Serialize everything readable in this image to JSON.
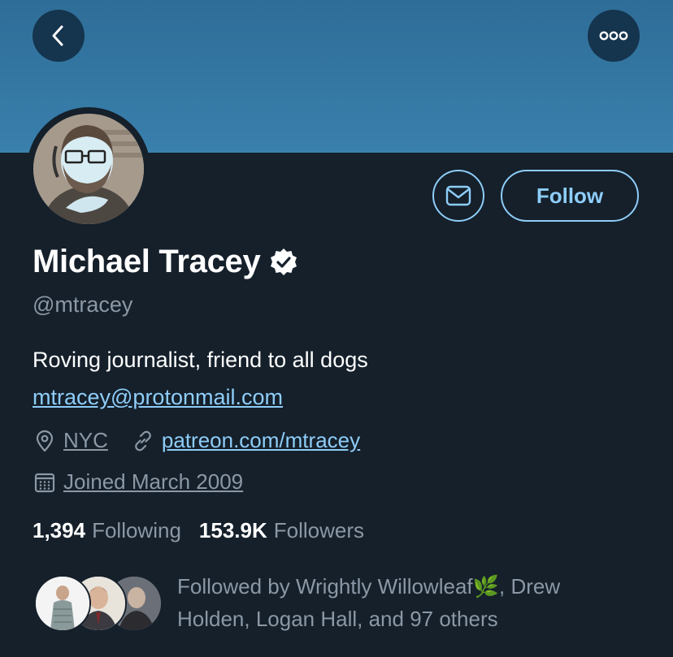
{
  "header": {
    "back_icon": "chevron-left-icon",
    "more_icon": "more-horizontal-icon",
    "banner_color": "#3a80ad"
  },
  "profile": {
    "name": "Michael Tracey",
    "verified_icon": "verified-badge-icon",
    "handle": "@mtracey",
    "bio": "Roving journalist, friend to all dogs",
    "email": "mtracey@protonmail.com",
    "location": "NYC",
    "website": "patreon.com/mtracey",
    "joined": "Joined March 2009"
  },
  "actions": {
    "message_icon": "envelope-icon",
    "follow_label": "Follow"
  },
  "stats": {
    "following_count": "1,394",
    "following_label": "Following",
    "followers_count": "153.9K",
    "followers_label": "Followers"
  },
  "followed_by": {
    "text": "Followed by Wrightly Willowleaf🌿, Drew Holden, Logan Hall, and 97 others"
  },
  "colors": {
    "background": "#15202b",
    "accent": "#8ecdf8",
    "secondary_text": "#8b98a5"
  }
}
